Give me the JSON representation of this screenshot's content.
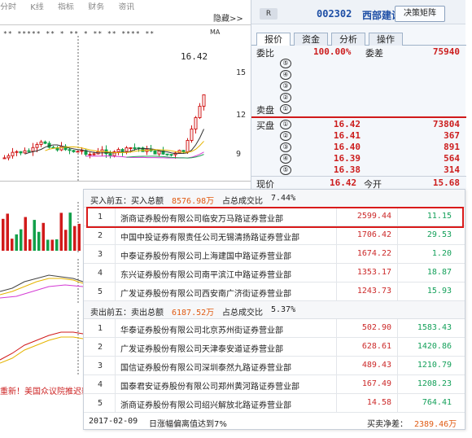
{
  "chart": {
    "menu_items": [
      "分时",
      "K线",
      "指标",
      "财务",
      "资讯"
    ],
    "hide_label": "隐藏>>",
    "stars_row": "** ***** ** *   **   *   ** **  **** **",
    "ma_label": "MA",
    "high_label": "16.42",
    "y_axis_labels": [
      "15",
      "12",
      "9"
    ],
    "ticker_text": "重新！美国众议院推迟新"
  },
  "quote": {
    "badge": "R",
    "code": "002302",
    "name": "西部建设",
    "decision_button": "决策矩阵",
    "tabs": [
      "报价",
      "资金",
      "分析",
      "操作"
    ],
    "weibi_label": "委比",
    "weibi_value": "100.00%",
    "weicha_label": "委差",
    "weicha_value": "75940",
    "sell_label": "卖盘",
    "buy_label": "买盘",
    "sell_levels": [
      {
        "n": "⑤",
        "price": "",
        "vol": ""
      },
      {
        "n": "④",
        "price": "",
        "vol": ""
      },
      {
        "n": "③",
        "price": "",
        "vol": ""
      },
      {
        "n": "②",
        "price": "",
        "vol": ""
      },
      {
        "n": "①",
        "price": "",
        "vol": ""
      }
    ],
    "buy_levels": [
      {
        "n": "①",
        "price": "16.42",
        "vol": "73804"
      },
      {
        "n": "②",
        "price": "16.41",
        "vol": "367"
      },
      {
        "n": "③",
        "price": "16.40",
        "vol": "891"
      },
      {
        "n": "④",
        "price": "16.39",
        "vol": "564"
      },
      {
        "n": "⑤",
        "price": "16.38",
        "vol": "314"
      }
    ],
    "footer_label": "现价",
    "footer_price": "16.42",
    "footer_open_label": "今开",
    "footer_open": "15.68"
  },
  "lhb": {
    "buy_section": {
      "title": "买入前五：买入总额",
      "total": "8576.98万",
      "ratio_label": "占总成交比",
      "ratio": "7.44%",
      "rows": [
        {
          "idx": "1",
          "name": "浙商证券股份有限公司临安万马路证券营业部",
          "buy": "2599.44",
          "sell": "11.15"
        },
        {
          "idx": "2",
          "name": "中国中投证券有限责任公司无锡清扬路证券营业部",
          "buy": "1706.42",
          "sell": "29.53"
        },
        {
          "idx": "3",
          "name": "中泰证券股份有限公司上海建国中路证券营业部",
          "buy": "1674.22",
          "sell": "1.20"
        },
        {
          "idx": "4",
          "name": "东兴证券股份有限公司南平滨江中路证券营业部",
          "buy": "1353.17",
          "sell": "18.87"
        },
        {
          "idx": "5",
          "name": "广发证券股份有限公司西安南广济街证券营业部",
          "buy": "1243.73",
          "sell": "15.93"
        }
      ]
    },
    "sell_section": {
      "title": "卖出前五：卖出总额",
      "total": "6187.52万",
      "ratio_label": "占总成交比",
      "ratio": "5.37%",
      "rows": [
        {
          "idx": "1",
          "name": "华泰证券股份有限公司北京苏州街证券营业部",
          "buy": "502.90",
          "sell": "1583.43"
        },
        {
          "idx": "2",
          "name": "广发证券股份有限公司天津泰安道证券营业部",
          "buy": "628.61",
          "sell": "1420.86"
        },
        {
          "idx": "3",
          "name": "国信证券股份有限公司深圳泰然九路证券营业部",
          "buy": "489.43",
          "sell": "1210.79"
        },
        {
          "idx": "4",
          "name": "国泰君安证券股份有限公司郑州黄河路证券营业部",
          "buy": "167.49",
          "sell": "1208.23"
        },
        {
          "idx": "5",
          "name": "浙商证券股份有限公司绍兴解放北路证券营业部",
          "buy": "14.58",
          "sell": "764.41"
        }
      ]
    },
    "footer_date": "2017-02-09",
    "footer_reason": "日涨幅偏离值达到7%",
    "footer_net_label": "买卖净差：",
    "footer_net_value": "2389.46万"
  },
  "colors": {
    "up": "#d11a1a",
    "down": "#12a04a",
    "ma5": "#333333",
    "ma10": "#e5b400",
    "ma20": "#d43bd4",
    "ma60": "#1fa055",
    "highlight": "#d91a1a"
  }
}
